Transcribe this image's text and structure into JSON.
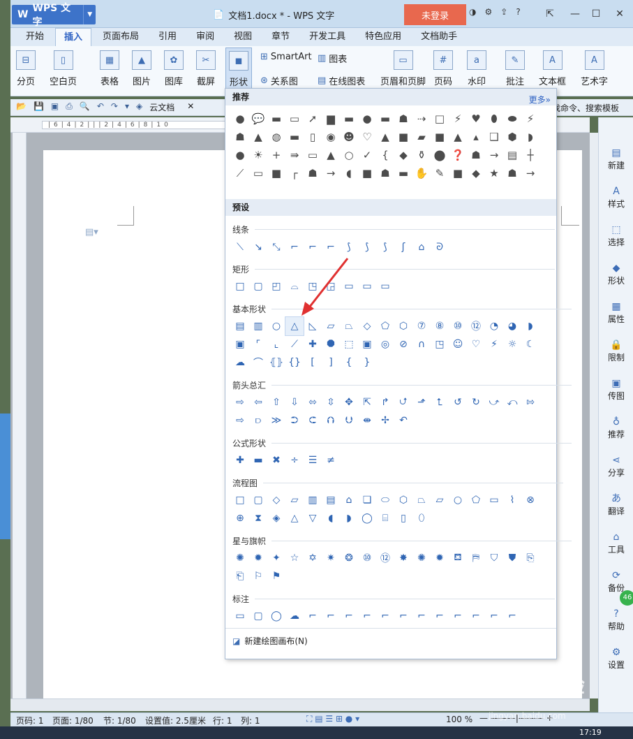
{
  "window": {
    "app_logo": "WPS 文字",
    "doc_title": "文档1.docx * - WPS 文字",
    "login_button": "未登录"
  },
  "tabs": [
    "开始",
    "插入",
    "页面布局",
    "引用",
    "审阅",
    "视图",
    "章节",
    "开发工具",
    "特色应用",
    "文档助手"
  ],
  "active_tab": "插入",
  "ribbon": {
    "fenye": "分页",
    "kongbaiye": "空白页",
    "biaoge": "表格",
    "tupian": "图片",
    "tuku": "图库",
    "jieping": "截屏",
    "xingzhuang": "形状",
    "smartart": "SmartArt",
    "guanxitu": "关系图",
    "tubiao": "图表",
    "zaixiantubiao": "在线图表",
    "yemeiyejiao": "页眉和页脚",
    "yema": "页码",
    "shuiyin": "水印",
    "pizhu": "批注",
    "wenbenkuang": "文本框",
    "yishuzi": "艺术字"
  },
  "qat": {
    "cloud_doc": "云文档",
    "search_hint": "找命令、搜索模板"
  },
  "popup": {
    "recommend": "推荐",
    "more": "更多»",
    "preset": "预设",
    "sections": {
      "lines": "线条",
      "rect": "矩形",
      "basic": "基本形状",
      "arrows": "箭头总汇",
      "formula": "公式形状",
      "flowchart": "流程图",
      "stars": "星与旗帜",
      "callouts": "标注"
    },
    "new_canvas": "新建绘图画布(N)"
  },
  "right_panel": [
    "新建",
    "样式",
    "选择",
    "形状",
    "属性",
    "限制",
    "传图",
    "推荐",
    "分享",
    "翻译",
    "工具",
    "备份",
    "帮助",
    "设置"
  ],
  "badge": "46",
  "status": {
    "page": "页码: 1",
    "pages": "页面: 1/80",
    "section": "节: 1/80",
    "setting": "设置值: 2.5厘米",
    "row": "行: 1",
    "col": "列: 1",
    "zoom": "100 %"
  },
  "taskbar": {
    "time": "17:19"
  },
  "watermark": "Baidu经验",
  "watermark_url": "jingyan.baidu.com"
}
